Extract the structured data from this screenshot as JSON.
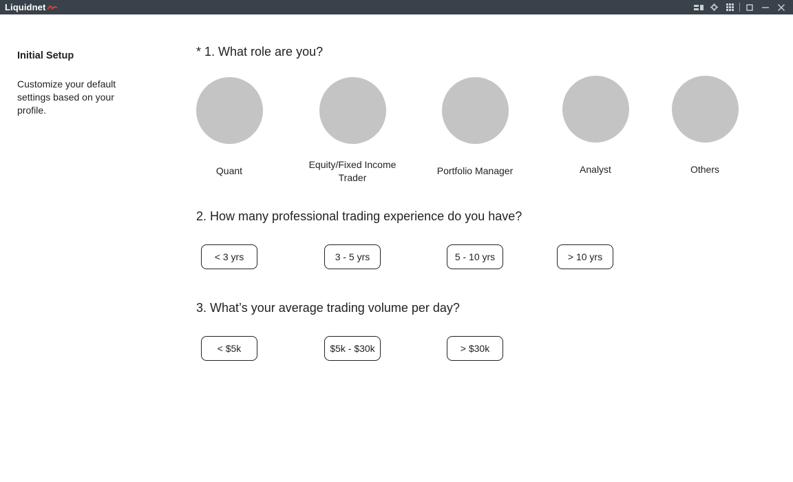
{
  "app": {
    "name": "Liquidnet"
  },
  "window_controls": [
    "layout-icon",
    "gear-icon",
    "grid-icon",
    "maximize-icon",
    "minimize-icon",
    "close-icon"
  ],
  "sidebar": {
    "title": "Initial Setup",
    "description": "Customize your default settings based on your profile."
  },
  "questions": {
    "role": {
      "label": "* 1. What role are you?",
      "options": [
        "Quant",
        "Equity/Fixed Income Trader",
        "Portfolio Manager",
        "Analyst",
        "Others"
      ]
    },
    "experience": {
      "label": "2. How many professional trading experience do you have?",
      "options": [
        "< 3 yrs",
        "3 - 5 yrs",
        "5 - 10 yrs",
        "> 10 yrs"
      ]
    },
    "volume": {
      "label": "3. What’s your average trading volume per day?",
      "options": [
        "< $5k",
        "$5k - $30k",
        "> $30k"
      ]
    }
  },
  "colors": {
    "titlebar": "#39424a",
    "avatar_placeholder": "#c4c4c4",
    "logo_accent": "#e0403a"
  }
}
